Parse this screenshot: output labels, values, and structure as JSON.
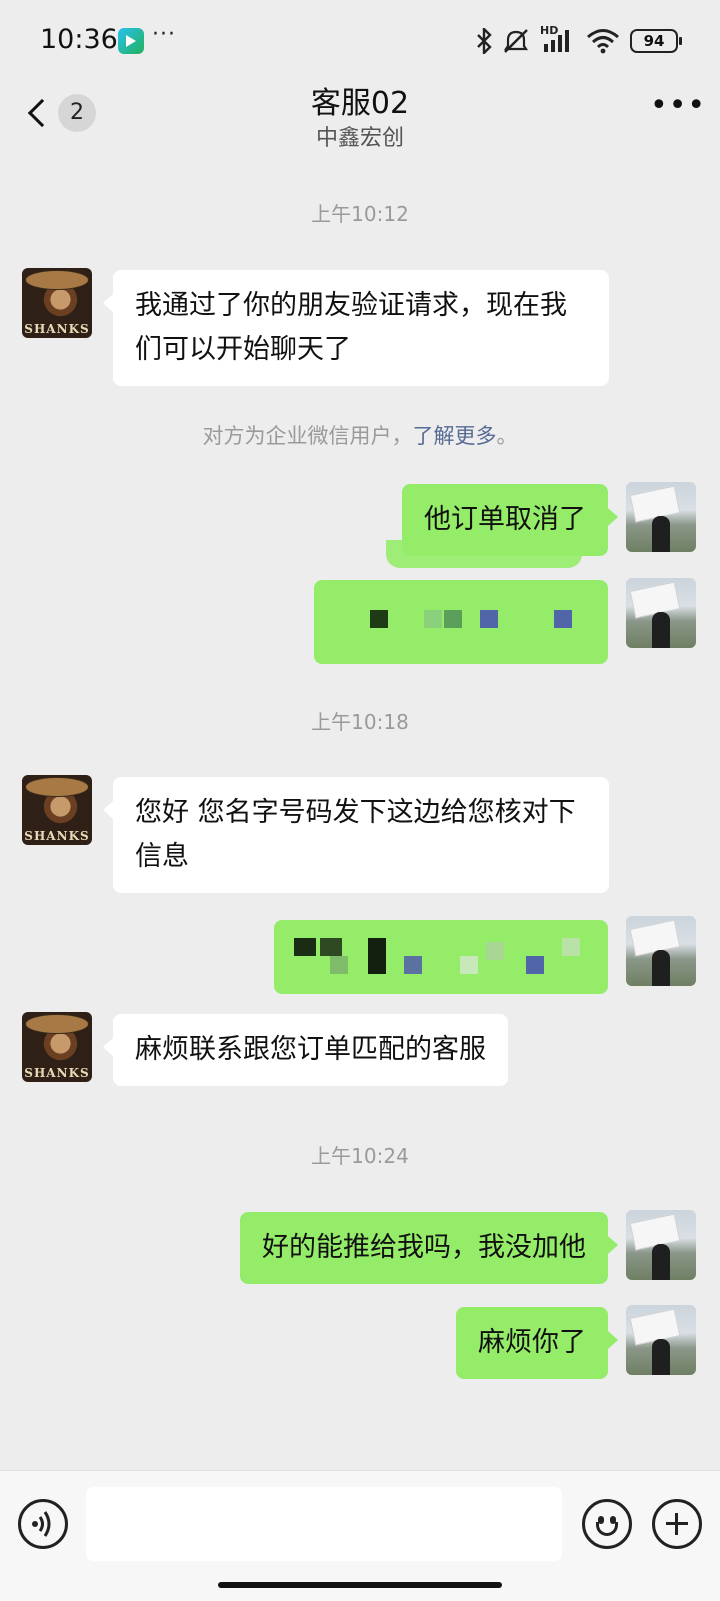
{
  "status_bar": {
    "time": "10:36",
    "dots": "···",
    "network": "HD",
    "battery": "94"
  },
  "header": {
    "back_icon": "chevron-left-icon",
    "unread_count": "2",
    "title": "客服02",
    "subtitle": "中鑫宏创",
    "more_icon": "more-horizontal-icon"
  },
  "messages": {
    "ts1": "上午10:12",
    "m1": "我通过了你的朋友验证请求，现在我们可以开始聊天了",
    "system_note": "对方为企业微信用户，",
    "system_link": "了解更多",
    "system_tail": "。",
    "m2": "他订单取消了",
    "ts2": "上午10:18",
    "m4": "您好  您名字号码发下这边给您核对下信息",
    "m6": "麻烦联系跟您订单匹配的客服",
    "ts3": "上午10:24",
    "m7": "好的能推给我吗，我没加他",
    "m8": "麻烦你了"
  },
  "input_bar": {
    "voice_icon": "voice-icon",
    "text_value": "",
    "emoji_icon": "emoji-icon",
    "plus_icon": "plus-icon"
  }
}
